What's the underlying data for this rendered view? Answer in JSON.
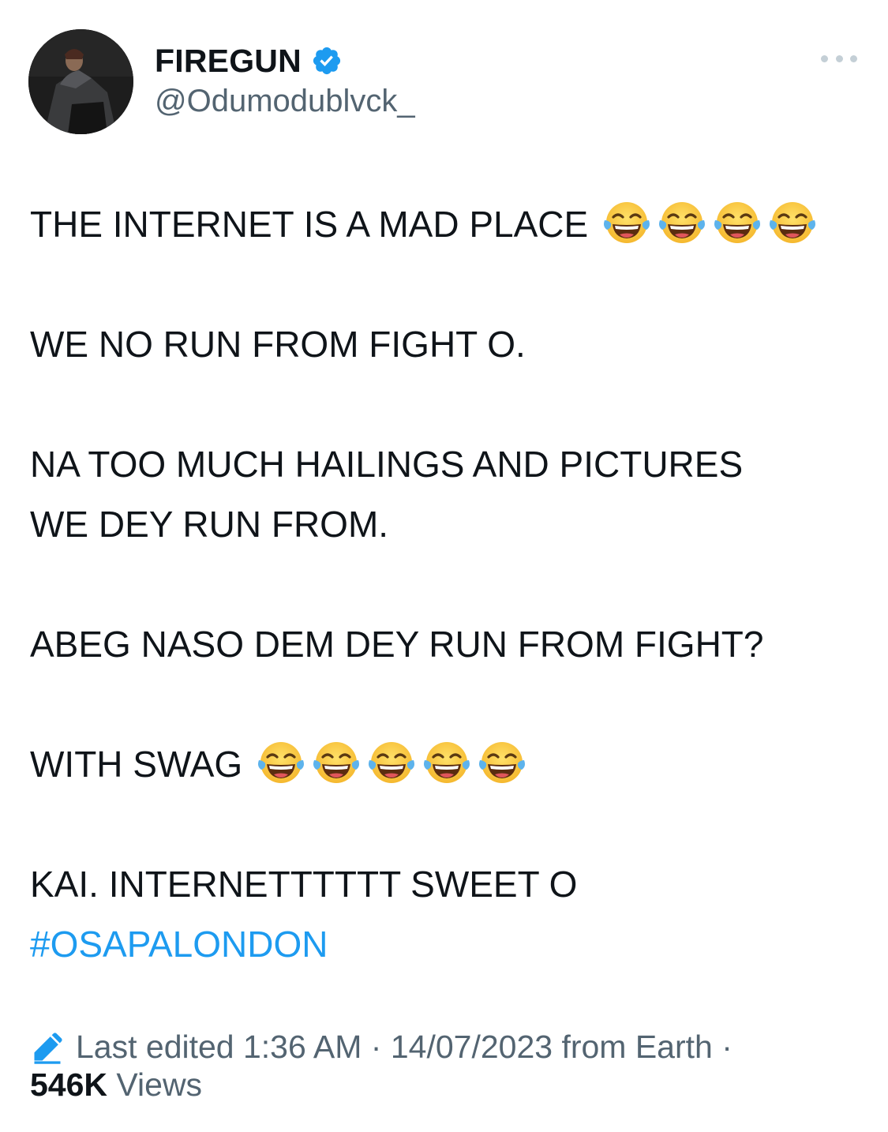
{
  "author": {
    "display_name": "FIREGUN",
    "handle": "@Odumodublvck_",
    "verified": true,
    "verified_color": "#1d9bf0"
  },
  "more_menu": {
    "icon": "more-horizontal-icon"
  },
  "tweet": {
    "lines": [
      "THE INTERNET IS A MAD PLACE",
      "WE NO RUN FROM FIGHT O.",
      "NA TOO MUCH HAILINGS AND PICTURES",
      "WE DEY RUN FROM.",
      "ABEG NASO DEM DEY RUN FROM FIGHT?",
      "WITH SWAG",
      "KAI. INTERNETTTTTT SWEET O"
    ],
    "hashtag": "#OSAPALONDON",
    "emoji_name": "face-with-tears-of-joy",
    "line1_emoji_count": 4,
    "line6_emoji_count": 5
  },
  "meta": {
    "edit_icon": "pencil-icon",
    "edited_text": "Last edited 1:36 AM · 14/07/2023  from Earth ·",
    "views_count": "546K",
    "views_label": "Views"
  },
  "colors": {
    "text": "#0f1419",
    "secondary": "#536471",
    "link": "#1d9bf0"
  }
}
